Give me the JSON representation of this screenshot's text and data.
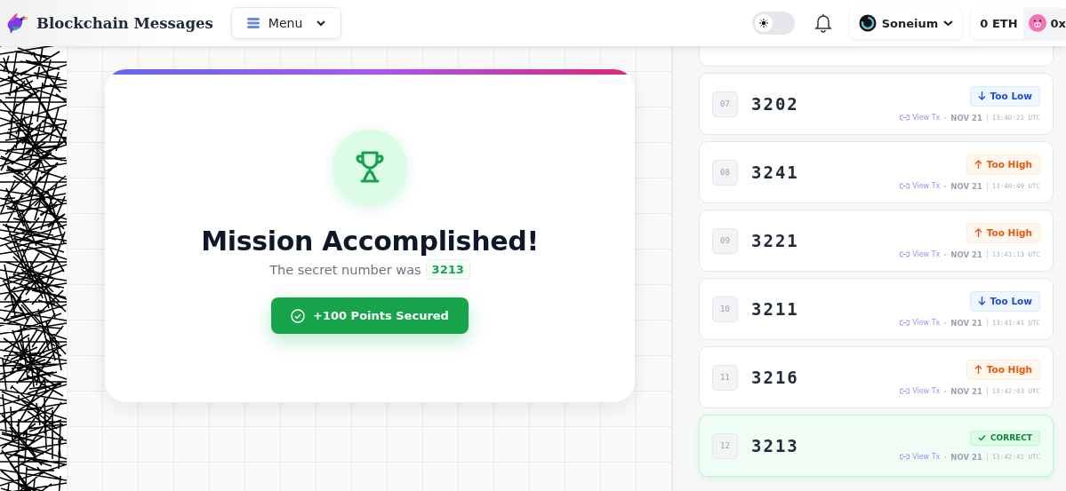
{
  "header": {
    "title": "Blockchain Messages",
    "menu_label": "Menu",
    "theme_toggle": {
      "on": false
    },
    "network": "Soneium",
    "balance": "0 ETH",
    "address": "0x"
  },
  "result": {
    "title": "Mission Accomplished!",
    "subtitle": "The secret number was",
    "secret": "3213",
    "reward": "+100 Points Secured"
  },
  "guesses": [
    {
      "kind": "low",
      "index": "07",
      "number": "3202",
      "badge": "Too Low",
      "link": "View Tx",
      "date": "NOV 21",
      "time": "13:40:21 UTC"
    },
    {
      "kind": "high",
      "index": "08",
      "number": "3241",
      "badge": "Too High",
      "link": "View Tx",
      "date": "NOV 21",
      "time": "13:40:49 UTC"
    },
    {
      "kind": "high",
      "index": "09",
      "number": "3221",
      "badge": "Too High",
      "link": "View Tx",
      "date": "NOV 21",
      "time": "13:41:13 UTC"
    },
    {
      "kind": "low",
      "index": "10",
      "number": "3211",
      "badge": "Too Low",
      "link": "View Tx",
      "date": "NOV 21",
      "time": "13:41:41 UTC"
    },
    {
      "kind": "high",
      "index": "11",
      "number": "3216",
      "badge": "Too High",
      "link": "View Tx",
      "date": "NOV 21",
      "time": "13:42:03 UTC"
    },
    {
      "kind": "correct",
      "index": "12",
      "number": "3213",
      "badge": "CORRECT",
      "link": "View Tx",
      "date": "NOV 21",
      "time": "13:42:41 UTC"
    }
  ]
}
